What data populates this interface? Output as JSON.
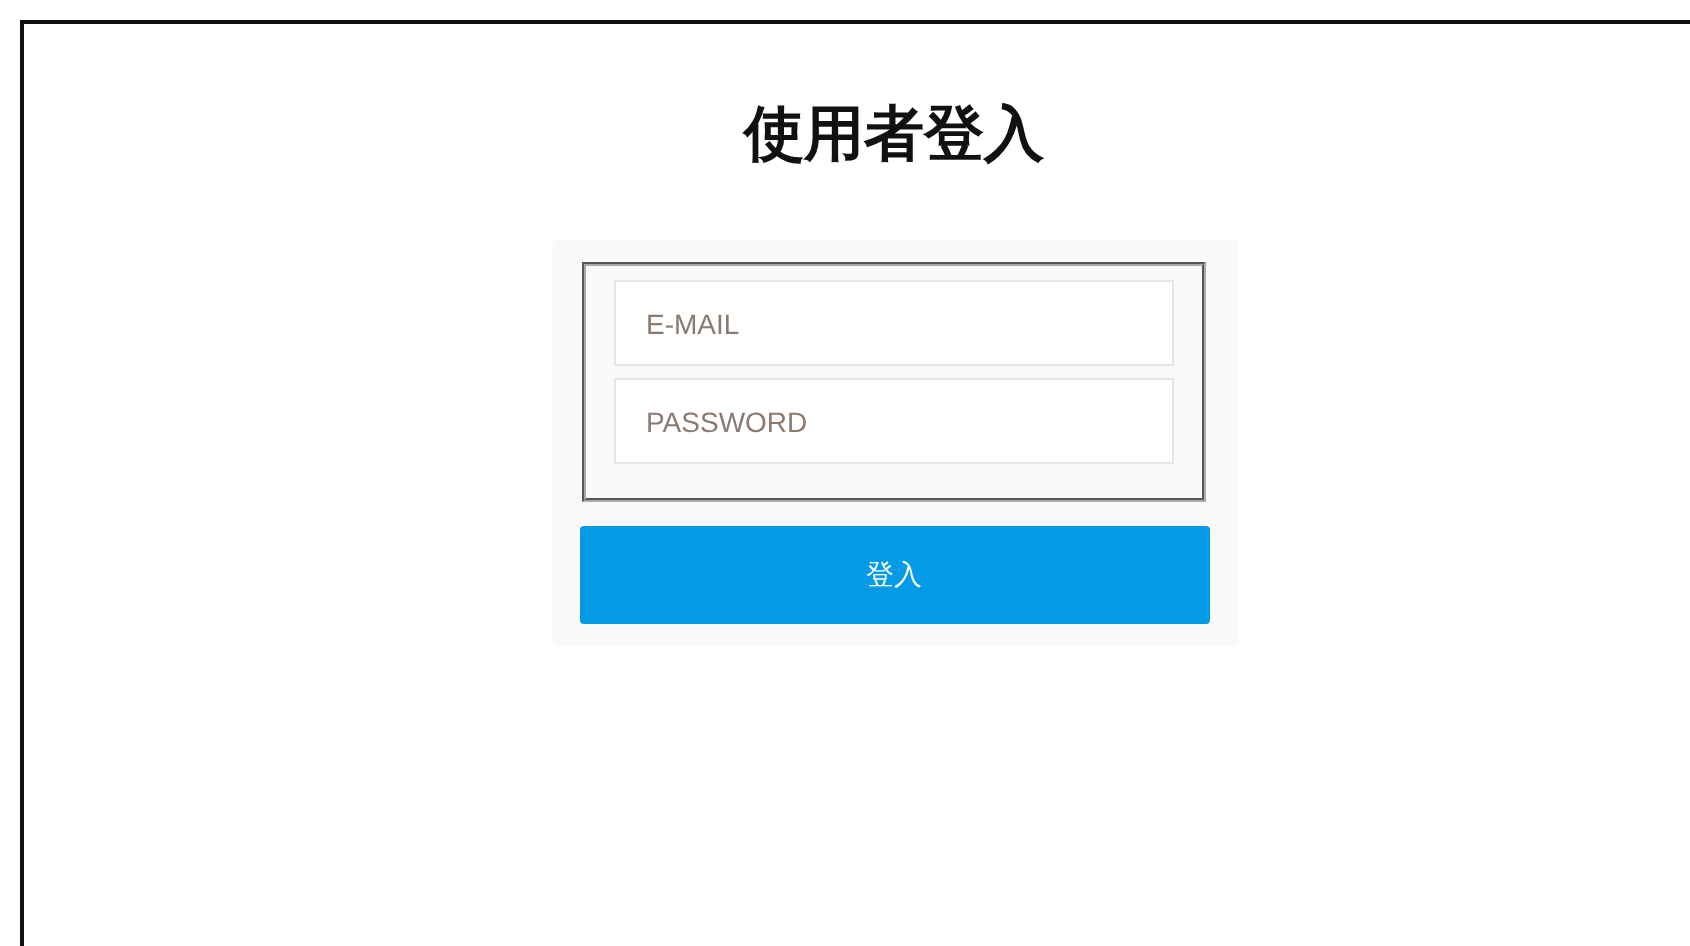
{
  "title": "使用者登入",
  "fields": [
    {
      "placeholder": "E-MAIL"
    },
    {
      "placeholder": "PASSWORD"
    }
  ],
  "button": "登入"
}
